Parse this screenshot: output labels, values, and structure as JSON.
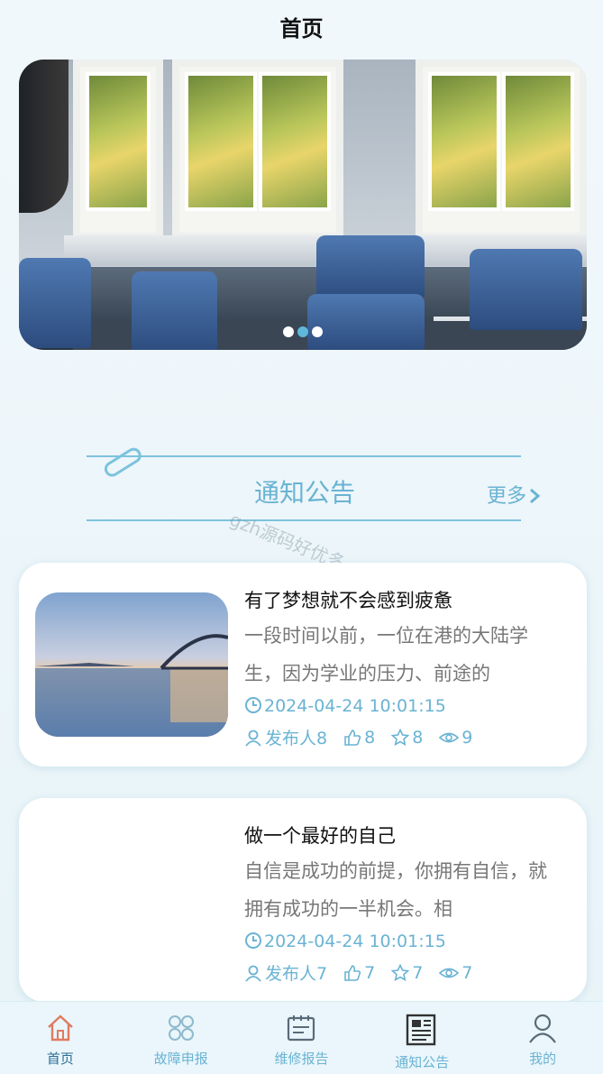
{
  "header": {
    "title": "首页"
  },
  "banner": {
    "slide_count": 3,
    "active_index": 1
  },
  "section": {
    "title": "通知公告",
    "more_label": "更多"
  },
  "watermark": "gzh源码好优多",
  "notices": [
    {
      "title": "有了梦想就不会感到疲惫",
      "desc": "一段时间以前，一位在港的大陆学生，因为学业的压力、前途的",
      "time": "2024-04-24 10:01:15",
      "author": "发布人8",
      "likes": "8",
      "favorites": "8",
      "views": "9"
    },
    {
      "title": "做一个最好的自己",
      "desc": "自信是成功的前提，你拥有自信，就拥有成功的一半机会。相",
      "time": "2024-04-24 10:01:15",
      "author": "发布人7",
      "likes": "7",
      "favorites": "7",
      "views": "7"
    }
  ],
  "tabbar": {
    "items": [
      {
        "label": "首页",
        "icon": "home-icon",
        "active": true
      },
      {
        "label": "故障申报",
        "icon": "grid-icon",
        "active": false
      },
      {
        "label": "维修报告",
        "icon": "calendar-icon",
        "active": false
      },
      {
        "label": "通知公告",
        "icon": "newspaper-icon",
        "active": false
      },
      {
        "label": "我的",
        "icon": "user-icon",
        "active": false
      }
    ]
  },
  "colors": {
    "accent": "#6ab3d3",
    "active_tab": "#2b6f97",
    "home_icon": "#e07a5f"
  }
}
